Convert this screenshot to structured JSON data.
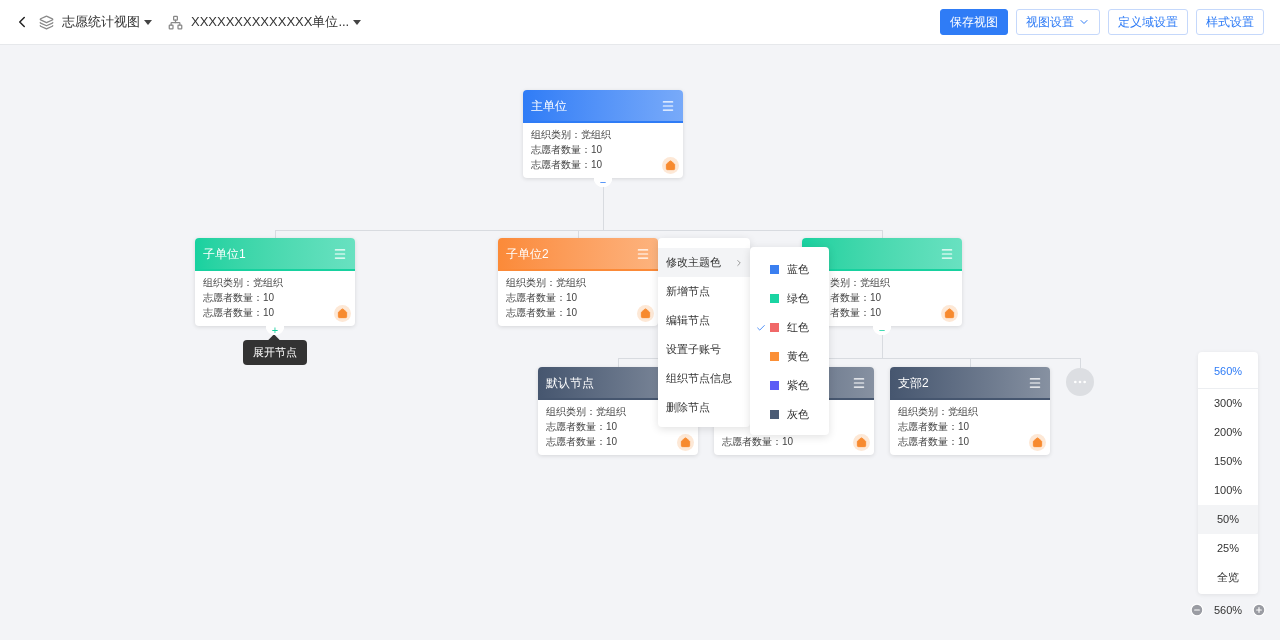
{
  "header": {
    "view_name": "志愿统计视图",
    "unit_name": "XXXXXXXXXXXXXX单位...",
    "buttons": [
      {
        "label": "保存视图",
        "primary": true,
        "dropdown": false
      },
      {
        "label": "视图设置",
        "primary": false,
        "dropdown": true
      },
      {
        "label": "定义域设置",
        "primary": false,
        "dropdown": false
      },
      {
        "label": "样式设置",
        "primary": false,
        "dropdown": false
      }
    ]
  },
  "nodes": [
    {
      "title": "主单位",
      "color": "#2f7cf6",
      "fields": [
        "组织类别：党组织",
        "志愿者数量：10",
        "志愿者数量：10"
      ],
      "toggle": "−"
    },
    {
      "title": "子单位1",
      "color": "#17d19f",
      "fields": [
        "组织类别：党组织",
        "志愿者数量：10",
        "志愿者数量：10"
      ],
      "toggle": "+",
      "tooltip": "展开节点"
    },
    {
      "title": "子单位2",
      "color": "#fb8a38",
      "fields": [
        "组织类别：党组织",
        "志愿者数量：10",
        "志愿者数量：10"
      ]
    },
    {
      "color": "#17d19f",
      "fields": [
        "类别：党组织",
        "者数量：10",
        "者数量：10"
      ],
      "toggle": "−"
    },
    {
      "title": "默认节点",
      "color": "#46566f",
      "fields": [
        "组织类别：党组织",
        "志愿者数量：10",
        "志愿者数量：10"
      ]
    },
    {
      "color": "#46566f",
      "fields": [
        "志愿者数量：10"
      ]
    },
    {
      "title": "支部2",
      "color": "#46566f",
      "fields": [
        "组织类别：党组织",
        "志愿者数量：10",
        "志愿者数量：10"
      ]
    }
  ],
  "context_menu": {
    "items": [
      {
        "label": "修改主题色",
        "submenu": true,
        "selected": true
      },
      {
        "label": "新增节点",
        "submenu": false,
        "selected": false
      },
      {
        "label": "编辑节点",
        "submenu": false,
        "selected": false
      },
      {
        "label": "设置子账号",
        "submenu": false,
        "selected": false
      },
      {
        "label": "组织节点信息",
        "submenu": false,
        "selected": false
      },
      {
        "label": "删除节点",
        "submenu": false,
        "selected": false
      }
    ]
  },
  "color_menu": {
    "items": [
      {
        "label": "蓝色",
        "color": "#3b7ff0",
        "selected": false
      },
      {
        "label": "绿色",
        "color": "#1ad4a2",
        "selected": false
      },
      {
        "label": "红色",
        "color": "#f06868",
        "selected": true
      },
      {
        "label": "黄色",
        "color": "#fb8f36",
        "selected": false
      },
      {
        "label": "紫色",
        "color": "#5c5cf5",
        "selected": false
      },
      {
        "label": "灰色",
        "color": "#4b5b75",
        "selected": false
      }
    ]
  },
  "zoom_menu": {
    "items": [
      {
        "label": "560%",
        "selected": true,
        "hovered": false
      },
      {
        "label": "300%",
        "selected": false,
        "hovered": false
      },
      {
        "label": "200%",
        "selected": false,
        "hovered": false
      },
      {
        "label": "150%",
        "selected": false,
        "hovered": false
      },
      {
        "label": "100%",
        "selected": false,
        "hovered": false
      },
      {
        "label": "50%",
        "selected": false,
        "hovered": true
      },
      {
        "label": "25%",
        "selected": false,
        "hovered": false
      },
      {
        "label": "全览",
        "selected": false,
        "hovered": false
      }
    ]
  },
  "zoom_value": "560%"
}
